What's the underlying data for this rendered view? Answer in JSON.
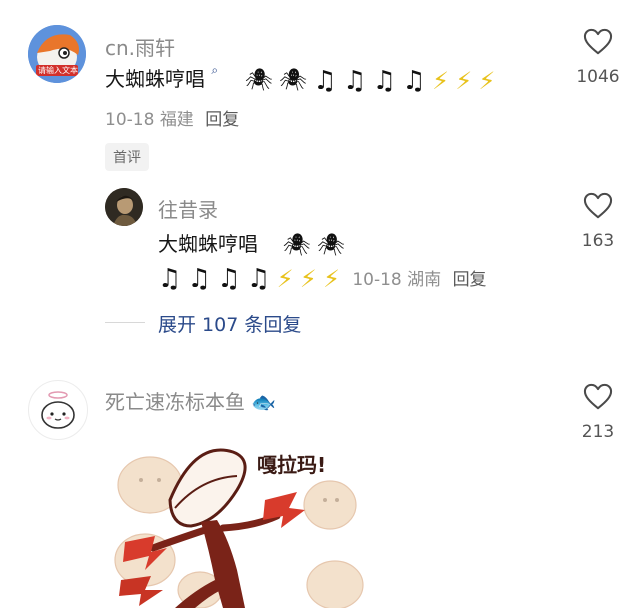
{
  "comments": [
    {
      "username": "cn.雨轩",
      "avatar_text": "请输入文本",
      "text": "大蜘蛛哼唱",
      "emoji_spiders": [
        "🕷",
        "🕷"
      ],
      "emoji_notes": [
        "♫",
        "♫",
        "♫",
        "♫"
      ],
      "emoji_bolts": [
        "⚡",
        "⚡",
        "⚡"
      ],
      "date": "10-18",
      "location": "福建",
      "reply_label": "回复",
      "likes": "1046",
      "badge": "首评"
    },
    {
      "username": "往昔录",
      "text": "大蜘蛛哼唱",
      "emoji_spiders": [
        "🕷",
        "🕷"
      ],
      "emoji_notes": [
        "♫",
        "♫",
        "♫",
        "♫"
      ],
      "emoji_bolts": [
        "⚡",
        "⚡",
        "⚡"
      ],
      "date": "10-18",
      "location": "湖南",
      "reply_label": "回复",
      "likes": "163"
    },
    {
      "username": "死亡速冻标本鱼",
      "fish_emoji": "🐟",
      "likes": "213",
      "sticker_text": "嘎拉玛!"
    }
  ],
  "expand_label": "展开 107 条回复",
  "colors": {
    "bolt": "#e8c21c",
    "link": "#2b4a8a",
    "muted": "#8a8a8a"
  }
}
